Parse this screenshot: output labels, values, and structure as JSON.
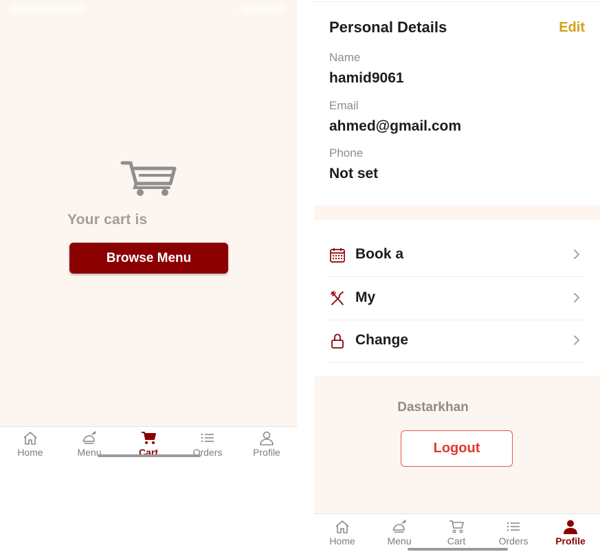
{
  "cart_screen": {
    "empty_message": "Your cart is",
    "browse_button": "Browse Menu"
  },
  "left_tabs": [
    {
      "label": "Home",
      "icon": "home-icon",
      "active": false
    },
    {
      "label": "Menu",
      "icon": "menu-food-icon",
      "active": false
    },
    {
      "label": "Cart",
      "icon": "cart-icon",
      "active": true
    },
    {
      "label": "Orders",
      "icon": "orders-list-icon",
      "active": false
    },
    {
      "label": "Profile",
      "icon": "profile-icon",
      "active": false
    }
  ],
  "profile_screen": {
    "section_title": "Personal Details",
    "edit_label": "Edit",
    "fields": [
      {
        "label": "Name",
        "value": "hamid9061"
      },
      {
        "label": "Email",
        "value": "ahmed@gmail.com"
      },
      {
        "label": "Phone",
        "value": "Not set"
      }
    ],
    "menu_items": [
      {
        "label": "Book a",
        "icon": "calendar-icon"
      },
      {
        "label": "My",
        "icon": "utensils-icon"
      },
      {
        "label": "Change",
        "icon": "lock-icon"
      }
    ],
    "brand": "Dastarkhan",
    "logout_label": "Logout"
  },
  "right_tabs": [
    {
      "label": "Home",
      "icon": "home-icon",
      "active": false
    },
    {
      "label": "Menu",
      "icon": "menu-food-icon",
      "active": false
    },
    {
      "label": "Cart",
      "icon": "cart-icon",
      "active": false
    },
    {
      "label": "Orders",
      "icon": "orders-list-icon",
      "active": false
    },
    {
      "label": "Profile",
      "icon": "profile-icon",
      "active": true
    }
  ],
  "colors": {
    "accent_dark_red": "#8b0000",
    "edit_gold": "#d4a017",
    "logout_red": "#e0392b",
    "cream_background": "#fdf5ef",
    "muted_text": "#8c8c8c"
  }
}
